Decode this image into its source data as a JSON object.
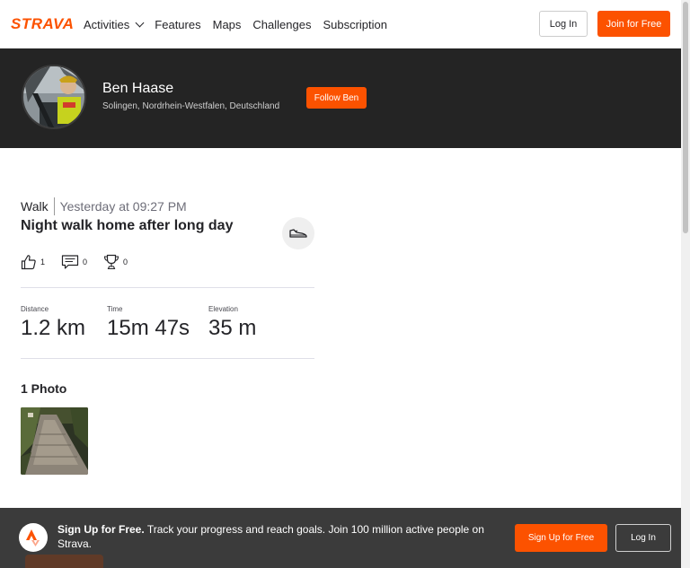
{
  "nav": {
    "logo": "STRAVA",
    "menu": [
      "Activities",
      "Features",
      "Maps",
      "Challenges",
      "Subscription"
    ],
    "login_label": "Log In",
    "join_label": "Join for Free"
  },
  "athlete": {
    "name": "Ben Haase",
    "location": "Solingen, Nordrhein-Westfalen, Deutschland",
    "follow_label": "Follow Ben"
  },
  "activity": {
    "type": "Walk",
    "date": "Yesterday at 09:27 PM",
    "title": "Night walk home after long day",
    "kudos": "1",
    "comments": "0",
    "achievements": "0",
    "stats": [
      {
        "label": "Distance",
        "value": "1.2 km"
      },
      {
        "label": "Time",
        "value": "15m 47s"
      },
      {
        "label": "Elevation",
        "value": "35 m"
      }
    ],
    "photos_heading": "1 Photo"
  },
  "banner": {
    "headline": "Sign Up for Free.",
    "text": "Track your progress and reach goals. Join 100 million active people on Strava.",
    "signup_label": "Sign Up for Free",
    "login_label": "Log In"
  },
  "colors": {
    "brand": "#fc5200",
    "header_bg": "#242424",
    "banner_bg": "#3b3b3b"
  },
  "icons": {
    "activities_menu": "chevron-down-icon",
    "kudos": "thumbs-up-icon",
    "comments": "comment-icon",
    "achievements": "trophy-icon",
    "gear": "shoe-icon",
    "banner_logo": "strava-chevron-icon"
  }
}
